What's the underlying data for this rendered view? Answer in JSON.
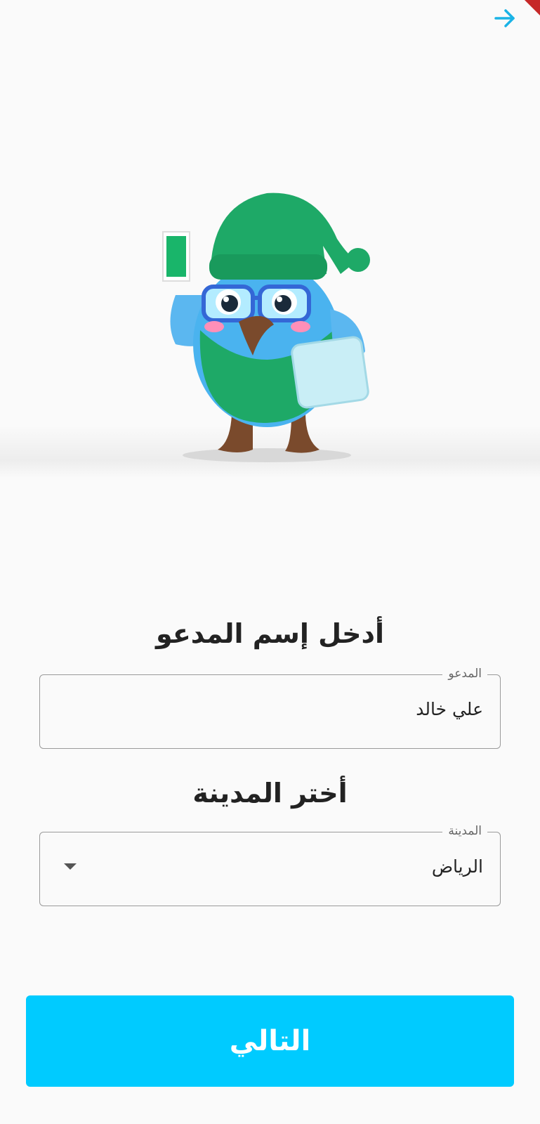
{
  "header": {
    "back_icon": "arrow-right-icon",
    "accent_color": "#1ab3e6"
  },
  "hero": {
    "illustration": "bird-mascot-with-green-hat-and-card"
  },
  "invitee": {
    "heading": "أدخل إسم المدعو",
    "field_label": "المدعو",
    "value": "علي خالد"
  },
  "city": {
    "heading": "أختر المدينة",
    "field_label": "المدينة",
    "selected": "الرياض",
    "dropdown_icon": "caret-down-icon"
  },
  "actions": {
    "next_label": "التالي",
    "button_color": "#00cbff"
  }
}
